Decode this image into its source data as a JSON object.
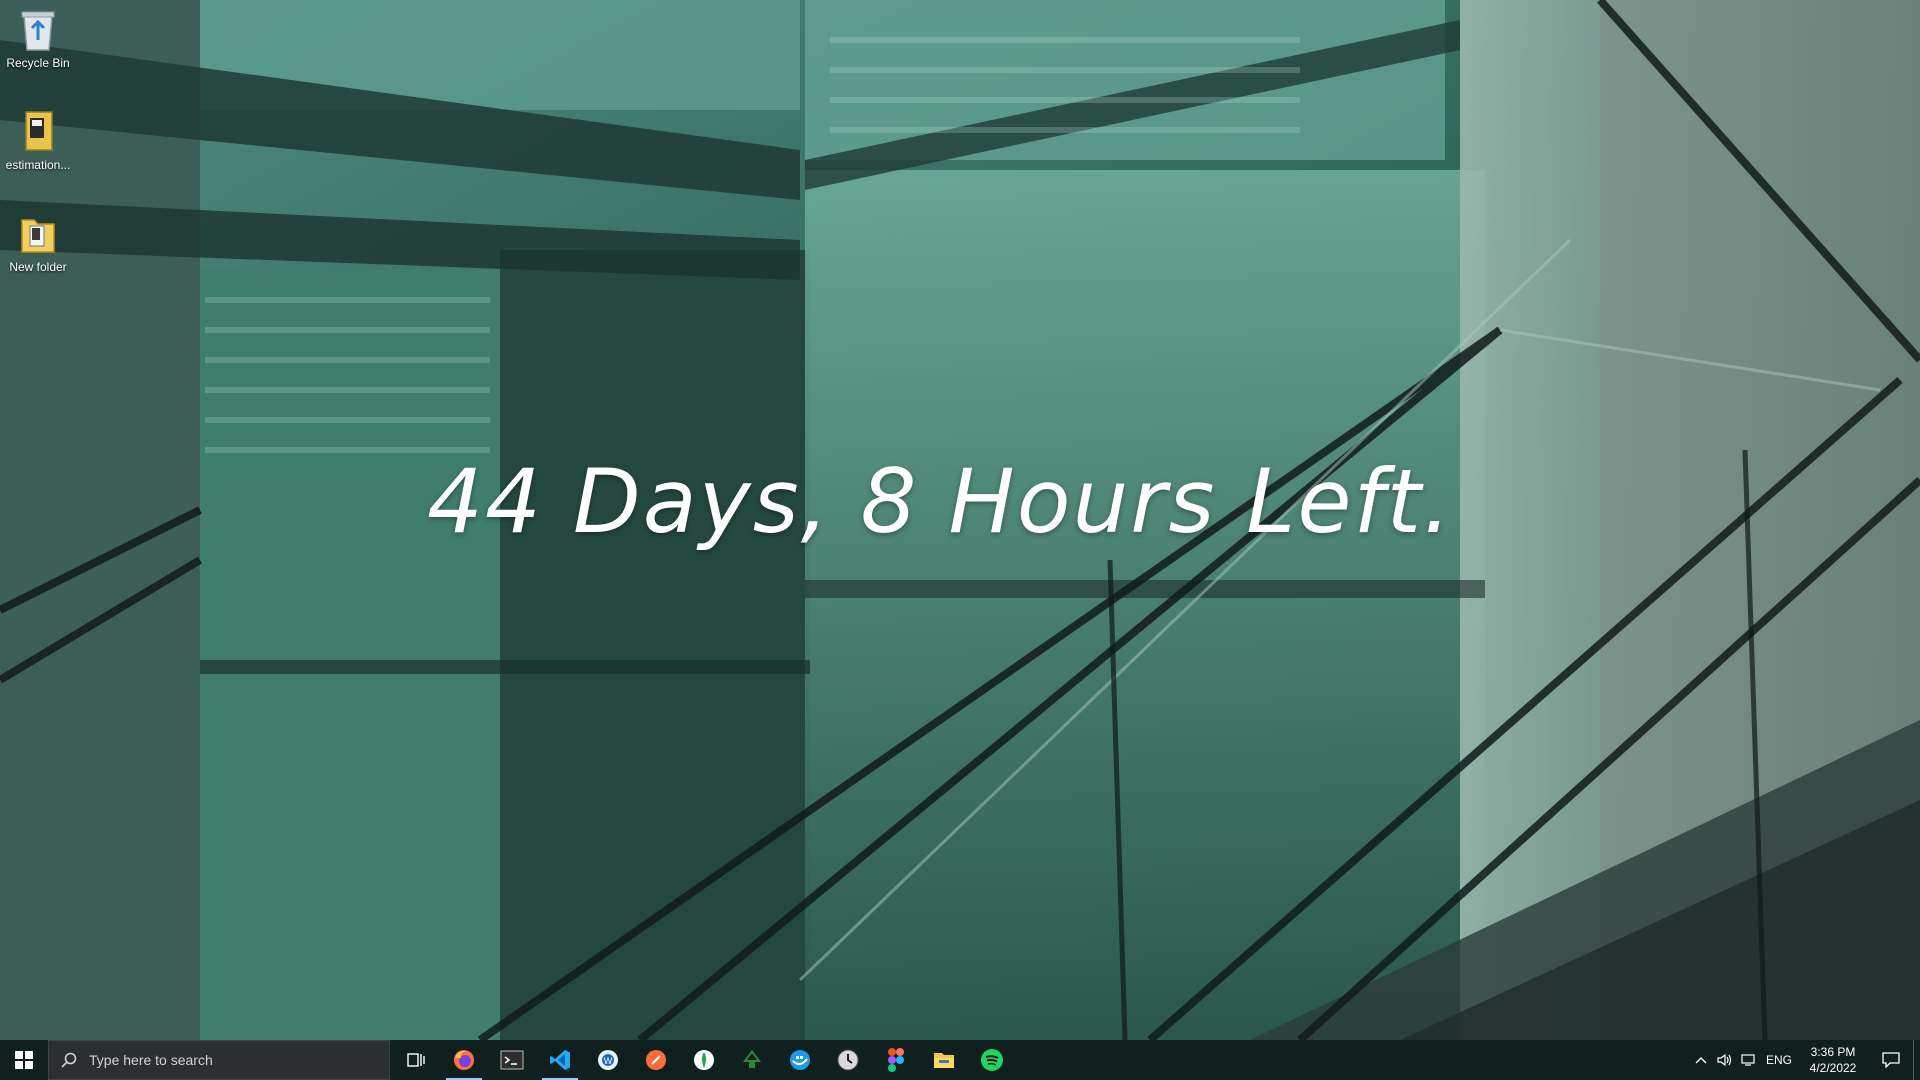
{
  "desktop_icons": [
    {
      "label": "Recycle Bin",
      "icon": "recycle-bin-icon"
    },
    {
      "label": "estimation...",
      "icon": "file-icon"
    },
    {
      "label": "New folder",
      "icon": "folder-icon"
    }
  ],
  "countdown": {
    "text": "44 Days, 8 Hours Left."
  },
  "taskbar": {
    "search_placeholder": "Type here to search",
    "apps": [
      {
        "name": "Firefox",
        "icon": "firefox-icon"
      },
      {
        "name": "Windows Terminal",
        "icon": "terminal-icon"
      },
      {
        "name": "Visual Studio Code",
        "icon": "vscode-icon"
      },
      {
        "name": "Browser",
        "icon": "browser-icon"
      },
      {
        "name": "Postman",
        "icon": "postman-icon"
      },
      {
        "name": "MongoDB Compass",
        "icon": "mongodb-icon"
      },
      {
        "name": "Inkscape",
        "icon": "inkscape-icon"
      },
      {
        "name": "Docker",
        "icon": "docker-icon"
      },
      {
        "name": "Clock app",
        "icon": "clock-app-icon"
      },
      {
        "name": "Figma",
        "icon": "figma-icon"
      },
      {
        "name": "File Explorer",
        "icon": "file-explorer-icon"
      },
      {
        "name": "Spotify",
        "icon": "spotify-icon"
      }
    ],
    "tray": {
      "language": "ENG",
      "time": "3:36 PM",
      "date": "4/2/2022"
    }
  },
  "colors": {
    "accent": "#9ec3ff",
    "taskbar_bg": "#101e1c",
    "wallpaper_base": "#2c5a4e"
  }
}
